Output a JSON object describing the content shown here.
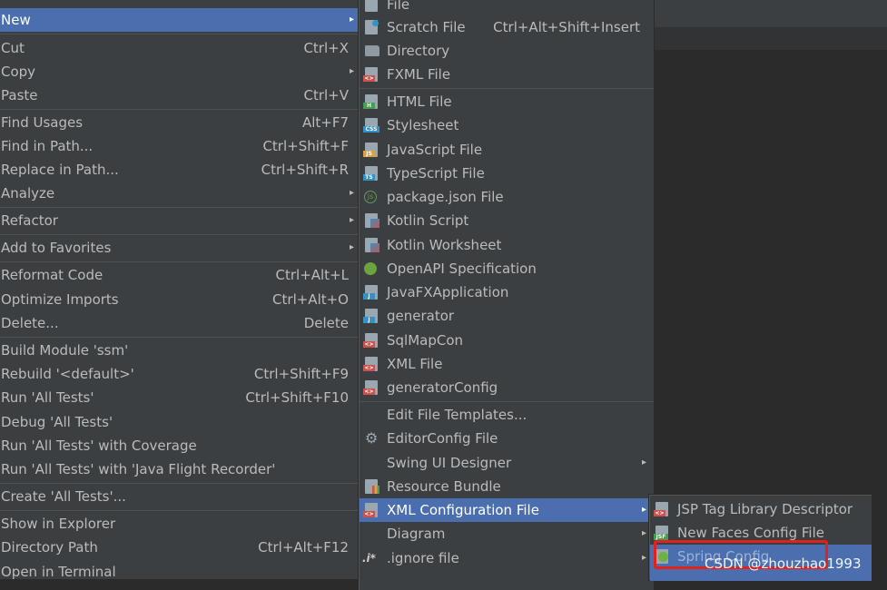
{
  "main_menu": [
    {
      "label": "New",
      "arrow": "▸",
      "selected": true
    },
    {
      "label": "Cut",
      "shortcut": "Ctrl+X"
    },
    {
      "label": "Copy",
      "arrow": "▸"
    },
    {
      "label": "Paste",
      "shortcut": "Ctrl+V"
    },
    {
      "label": "Find Usages",
      "shortcut": "Alt+F7"
    },
    {
      "label": "Find in Path...",
      "shortcut": "Ctrl+Shift+F"
    },
    {
      "label": "Replace in Path...",
      "shortcut": "Ctrl+Shift+R"
    },
    {
      "label": "Analyze",
      "arrow": "▸"
    },
    {
      "label": "Refactor",
      "arrow": "▸"
    },
    {
      "label": "Add to Favorites",
      "arrow": "▸"
    },
    {
      "label": "Reformat Code",
      "shortcut": "Ctrl+Alt+L"
    },
    {
      "label": "Optimize Imports",
      "shortcut": "Ctrl+Alt+O"
    },
    {
      "label": "Delete...",
      "shortcut": "Delete"
    },
    {
      "label": "Build Module 'ssm'"
    },
    {
      "label": "Rebuild '<default>'",
      "shortcut": "Ctrl+Shift+F9"
    },
    {
      "label": "Run 'All Tests'",
      "shortcut": "Ctrl+Shift+F10"
    },
    {
      "label": "Debug 'All Tests'"
    },
    {
      "label": "Run 'All Tests' with Coverage"
    },
    {
      "label": "Run 'All Tests' with 'Java Flight Recorder'"
    },
    {
      "label": "Create 'All Tests'..."
    },
    {
      "label": "Show in Explorer"
    },
    {
      "label": "Directory Path",
      "shortcut": "Ctrl+Alt+F12"
    },
    {
      "label": "Open in Terminal"
    }
  ],
  "new_menu": [
    {
      "label": "File",
      "icon": "file-icon"
    },
    {
      "label": "Scratch File",
      "shortcut": "Ctrl+Alt+Shift+Insert",
      "icon": "scratch-file-icon"
    },
    {
      "label": "Directory",
      "icon": "folder-icon"
    },
    {
      "label": "FXML File",
      "icon": "fxml-file-icon"
    },
    {
      "label": "HTML File",
      "icon": "html-file-icon",
      "tag": "H"
    },
    {
      "label": "Stylesheet",
      "icon": "css-file-icon",
      "tag": "CSS"
    },
    {
      "label": "JavaScript File",
      "icon": "js-file-icon",
      "tag": "JS"
    },
    {
      "label": "TypeScript File",
      "icon": "ts-file-icon",
      "tag": "TS"
    },
    {
      "label": "package.json File",
      "icon": "nodejs-icon"
    },
    {
      "label": "Kotlin Script",
      "icon": "kotlin-script-icon"
    },
    {
      "label": "Kotlin Worksheet",
      "icon": "kotlin-worksheet-icon"
    },
    {
      "label": "OpenAPI Specification",
      "icon": "openapi-icon"
    },
    {
      "label": "JavaFXApplication",
      "icon": "javafx-icon",
      "tag": "J"
    },
    {
      "label": "generator",
      "icon": "java-template-icon",
      "tag": "J"
    },
    {
      "label": "SqlMapCon",
      "icon": "xml-template-icon",
      "tag": "<>"
    },
    {
      "label": "XML File",
      "icon": "xml-file-icon",
      "tag": "<>"
    },
    {
      "label": "generatorConfig",
      "icon": "xml-template-icon",
      "tag": "<>"
    },
    {
      "label": "Edit File Templates..."
    },
    {
      "label": "EditorConfig File",
      "icon": "gear-icon"
    },
    {
      "label": "Swing UI Designer",
      "arrow": "▸"
    },
    {
      "label": "Resource Bundle",
      "icon": "resource-bundle-icon"
    },
    {
      "label": "XML Configuration File",
      "arrow": "▸",
      "selected": true,
      "icon": "xml-config-icon",
      "tag": "<>"
    },
    {
      "label": "Diagram",
      "arrow": "▸"
    },
    {
      "label": ".ignore file",
      "arrow": "▸",
      "icon": "ignore-file-icon"
    }
  ],
  "xml_submenu": [
    {
      "label": "JSP Tag Library Descriptor",
      "icon": "jsp-tld-icon",
      "tag": "<>"
    },
    {
      "label": "New Faces Config File",
      "icon": "jsf-icon",
      "tag": "JSF"
    },
    {
      "label": "Spring Config",
      "icon": "spring-icon",
      "selected": true
    }
  ],
  "watermark": "CSDN @zhouzhao1993",
  "colors": {
    "menu_bg": "#3c3f41",
    "selection": "#4b6eaf",
    "text": "#bbbbbb",
    "highlight_box": "#e0211c"
  }
}
